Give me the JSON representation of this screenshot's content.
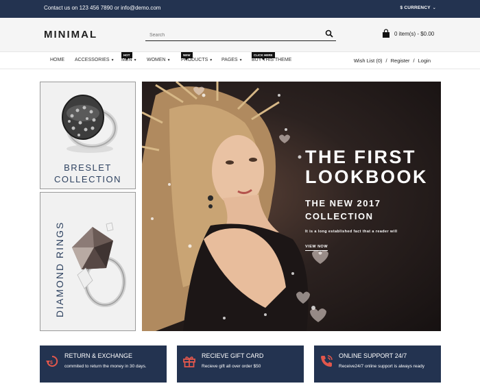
{
  "topbar": {
    "contact": "Contact us on 123 456 7890 or info@demo.com",
    "currency": "$ CURRENCY"
  },
  "header": {
    "logo": "MINIMAL",
    "search_placeholder": "Search",
    "cart": "0 item(s) - $0.00"
  },
  "nav": {
    "items": [
      {
        "label": "HOME"
      },
      {
        "label": "ACCESSORIES"
      },
      {
        "label": "MEN",
        "badge": "HOT"
      },
      {
        "label": "WOMEN"
      },
      {
        "label": "PRODUCTS",
        "badge": "NEW"
      },
      {
        "label": "PAGES"
      },
      {
        "label": "BUY THIS THEME",
        "badge": "CLICK HERE"
      }
    ],
    "wishlist": "Wish List (0)",
    "register": "Register",
    "login": "Login",
    "separator": "/"
  },
  "side": {
    "bracelet": {
      "line1": "BRESLET",
      "line2": "COLLECTION"
    },
    "diamond": "DIAMOND RINGS"
  },
  "hero": {
    "title_line1": "THE FIRST",
    "title_line2": "LOOKBOOK",
    "subtitle_line1": "THE NEW 2017",
    "subtitle_line2": "COLLECTION",
    "description": "It is a long established fact that a reader will",
    "cta": "VIEW NOW"
  },
  "services": [
    {
      "title": "RETURN & EXCHANGE",
      "desc": "commited to return the money in 30 days.",
      "icon": "return-icon"
    },
    {
      "title": "RECIEVE GIFT CARD",
      "desc": "Recieve gift all over order $50",
      "icon": "gift-icon"
    },
    {
      "title": "ONLINE SUPPORT 24/7",
      "desc": "Receive24/7 online support is always ready",
      "icon": "phone-icon"
    }
  ],
  "colors": {
    "navy": "#233350",
    "accent": "#e2574c"
  }
}
